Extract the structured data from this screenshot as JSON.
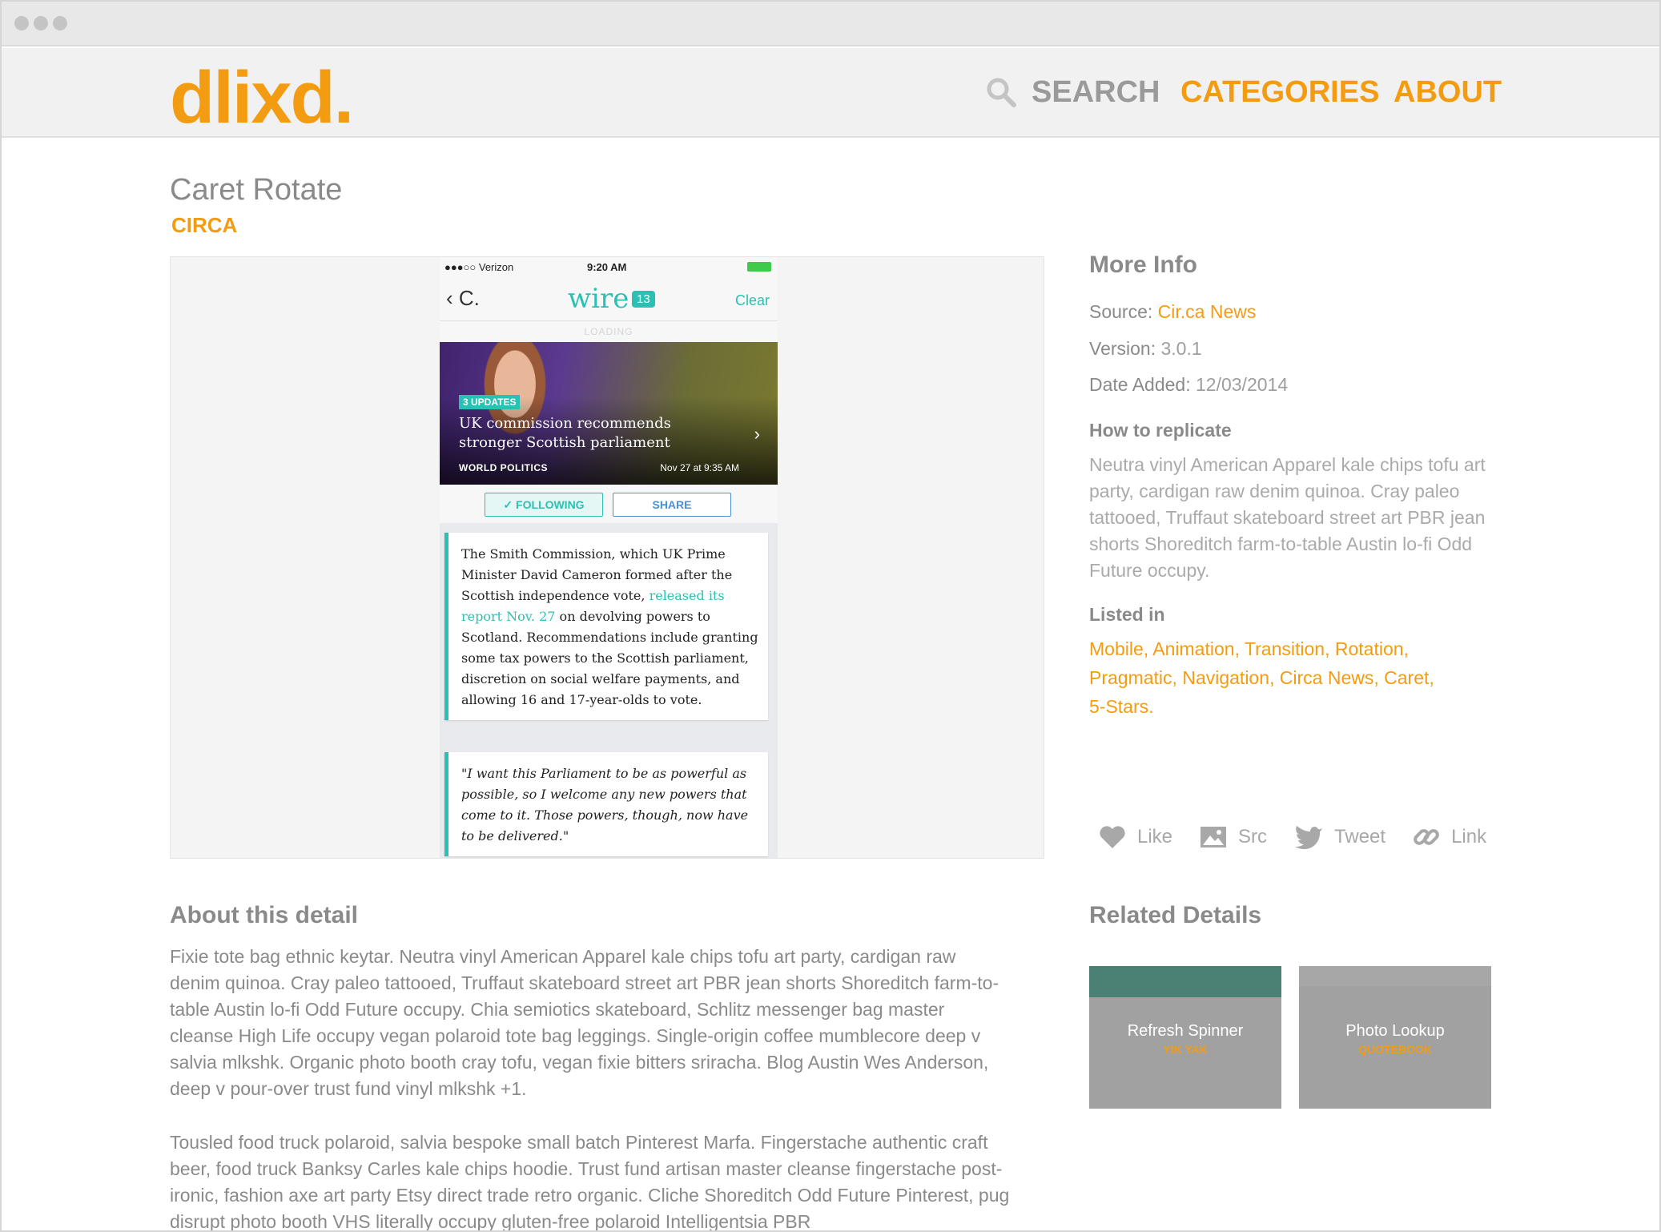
{
  "colors": {
    "accent": "#f39c12",
    "teal": "#2bc0b4",
    "text_gray": "#8a8a8a"
  },
  "site": {
    "logo": "dlixd.",
    "nav": {
      "search": "SEARCH",
      "categories": "CATEGORIES",
      "about": "ABOUT"
    }
  },
  "detail": {
    "title": "Caret Rotate",
    "app": "CIRCA"
  },
  "phone": {
    "carrier": "●●●○○ Verizon",
    "time": "9:20 AM",
    "back": "C.",
    "app_title": "wire",
    "badge": "13",
    "clear": "Clear",
    "loading": "LOADING",
    "hero": {
      "updates": "3 UPDATES",
      "headline": "UK commission recommends stronger Scottish parliament",
      "category": "WORLD POLITICS",
      "date": "Nov 27 at 9:35 AM"
    },
    "following": "✓ FOLLOWING",
    "share": "SHARE",
    "card1": {
      "before": "The Smith Commission, which UK Prime Minister David Cameron formed after the Scottish independence vote, ",
      "link": "released its report Nov. 27",
      "after": " on devolving powers to Scotland. Recommendations include granting some tax powers to the Scottish parliament, discretion on social welfare payments, and allowing 16 and 17-year-olds to vote."
    },
    "card2": "\"I want this Parliament to be as powerful as possible, so I welcome any new powers that come to it. Those powers, though, now have to be delivered.\""
  },
  "more_info": {
    "heading": "More Info",
    "source_label": "Source:",
    "source_value": "Cir.ca News",
    "version_label": "Version:",
    "version_value": "3.0.1",
    "date_label": "Date Added:",
    "date_value": "12/03/2014",
    "howto_heading": "How to replicate",
    "howto_text": "Neutra vinyl American Apparel kale chips tofu art party, cardigan raw denim quinoa. Cray paleo tattooed, Truffaut skateboard street art PBR jean shorts Shoreditch farm-to-table Austin lo-fi Odd Future occupy.",
    "listed_heading": "Listed in",
    "tags": [
      "Mobile",
      "Animation",
      "Transition",
      "Rotation",
      "Pragmatic",
      "Navigation",
      "Circa News",
      "Caret",
      "5-Stars"
    ]
  },
  "actions": {
    "like": "Like",
    "src": "Src",
    "tweet": "Tweet",
    "link": "Link"
  },
  "about": {
    "heading": "About this detail",
    "p1": "Fixie tote bag ethnic keytar. Neutra vinyl American Apparel kale chips tofu art party, cardigan raw denim quinoa. Cray paleo tattooed, Truffaut skateboard street art PBR jean shorts Shoreditch farm-to-table Austin lo-fi Odd Future occupy. Chia semiotics skateboard, Schlitz messenger bag master cleanse High Life occupy vegan polaroid tote bag leggings. Single-origin coffee mumblecore deep v salvia mlkshk. Organic photo booth cray tofu, vegan fixie bitters sriracha. Blog Austin Wes Anderson, deep v pour-over trust fund vinyl mlkshk +1.",
    "p2": "Tousled food truck polaroid, salvia bespoke small batch Pinterest Marfa. Fingerstache authentic craft beer, food truck Banksy Carles kale chips hoodie. Trust fund artisan master cleanse fingerstache post-ironic, fashion axe art party Etsy direct trade retro organic. Cliche Shoreditch Odd Future Pinterest, pug disrupt photo booth VHS literally occupy gluten-free polaroid Intelligentsia PBR"
  },
  "related": {
    "heading": "Related Details",
    "items": [
      {
        "title": "Refresh Spinner",
        "app": "YIK YAK"
      },
      {
        "title": "Photo Lookup",
        "app": "QUOTEBOOK"
      }
    ]
  }
}
